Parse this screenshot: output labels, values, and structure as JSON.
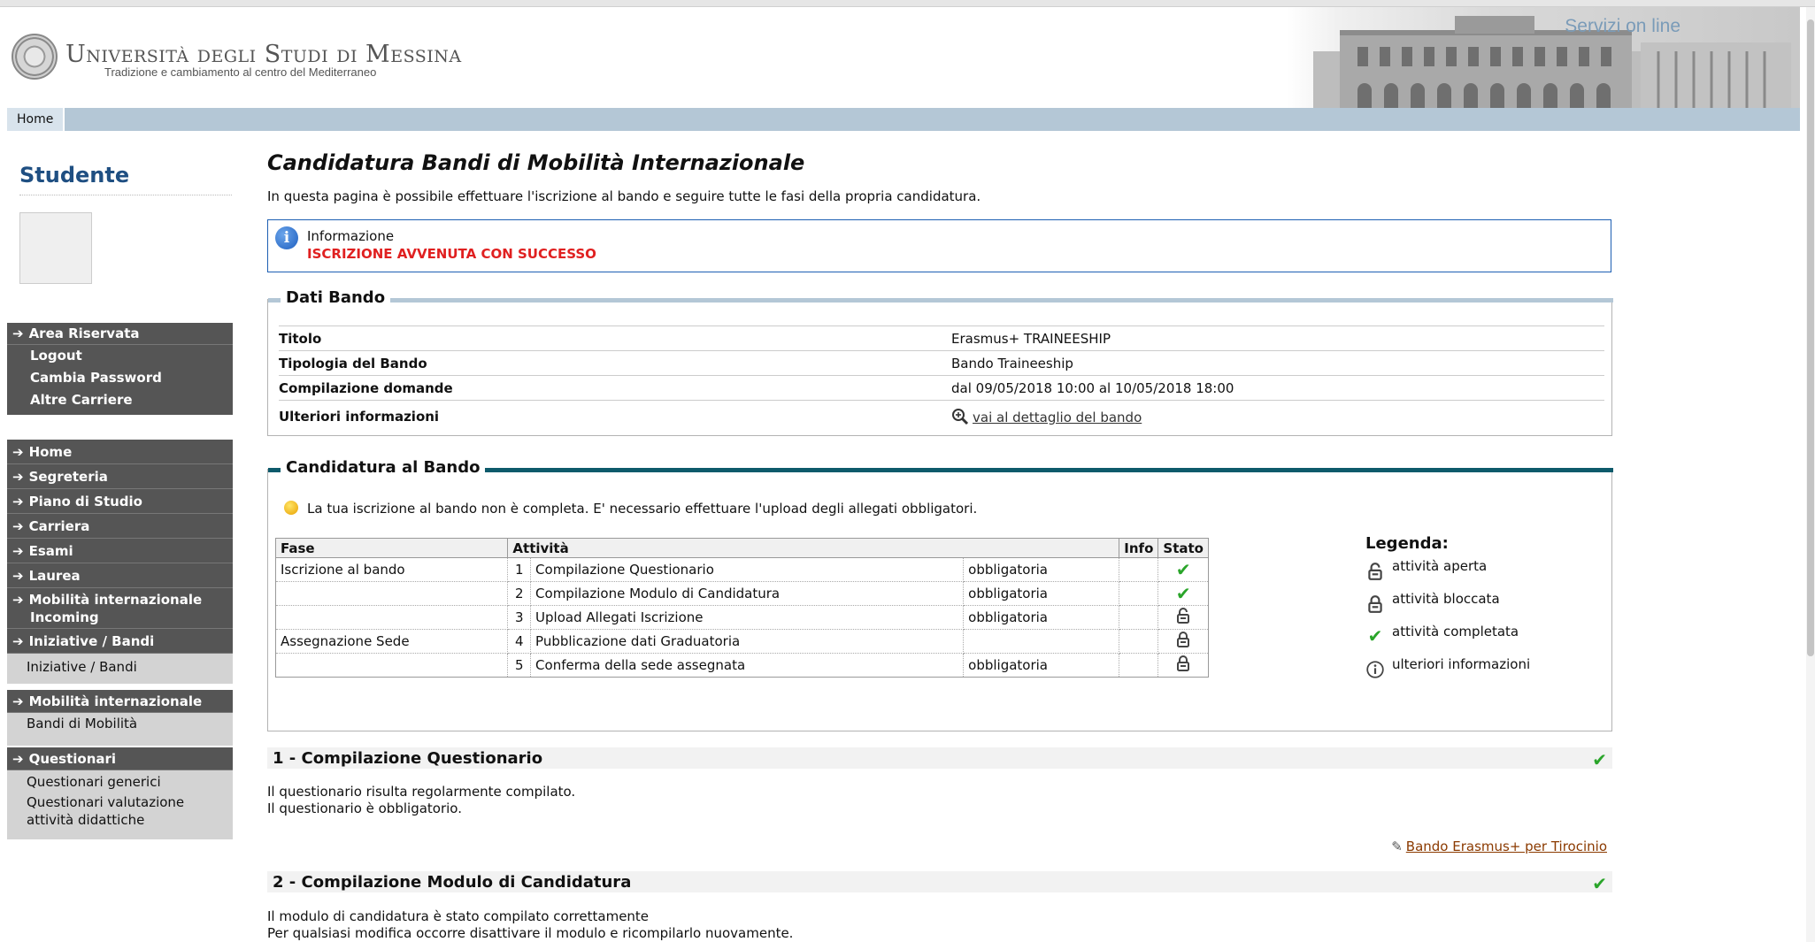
{
  "header": {
    "university": "Università degli Studi di Messina",
    "motto": "Tradizione e cambiamento al centro del Mediterraneo",
    "banner_title": "Servizi on line"
  },
  "navbar": {
    "home": "Home"
  },
  "sidebar": {
    "title": "Studente",
    "area": {
      "header": "Area Riservata",
      "items": [
        "Logout",
        "Cambia Password",
        "Altre Carriere"
      ]
    },
    "menu": [
      "Home",
      "Segreteria",
      "Piano di Studio",
      "Carriera",
      "Esami",
      "Laurea",
      "Mobilità internazionale Incoming",
      "Iniziative / Bandi"
    ],
    "iniziative_sub": "Iniziative / Bandi",
    "mobilita_header": "Mobilità internazionale",
    "mobilita_sub": "Bandi di Mobilità",
    "questionari_header": "Questionari",
    "questionari_sub": [
      "Questionari generici",
      "Questionari valutazione attività didattiche"
    ]
  },
  "main": {
    "title": "Candidatura Bandi di Mobilità Internazionale",
    "description": "In questa pagina è possibile effettuare l'iscrizione al bando e seguire tutte le fasi della propria candidatura.",
    "info": {
      "label": "Informazione",
      "message": "ISCRIZIONE AVVENUTA CON SUCCESSO"
    },
    "dati_bando": {
      "legend": "Dati Bando",
      "rows": [
        {
          "key": "Titolo",
          "value": "Erasmus+ TRAINEESHIP"
        },
        {
          "key": "Tipologia del Bando",
          "value": "Bando Traineeship"
        },
        {
          "key": "Compilazione domande",
          "value": "dal 09/05/2018 10:00 al 10/05/2018 18:00"
        },
        {
          "key": "Ulteriori informazioni",
          "value": "vai al dettaglio del bando"
        }
      ]
    },
    "candidatura": {
      "legend": "Candidatura al Bando",
      "note": "La tua iscrizione al bando non è completa. E' necessario effettuare l'upload degli allegati obbligatori.",
      "headers": {
        "fase": "Fase",
        "attivita": "Attività",
        "info": "Info",
        "stato": "Stato"
      },
      "rows": [
        {
          "fase": "Iscrizione al bando",
          "num": "1",
          "attivita": "Compilazione Questionario",
          "obbl": "obbligatoria",
          "stato": "completed"
        },
        {
          "fase": "",
          "num": "2",
          "attivita": "Compilazione Modulo di Candidatura",
          "obbl": "obbligatoria",
          "stato": "completed"
        },
        {
          "fase": "",
          "num": "3",
          "attivita": "Upload Allegati Iscrizione",
          "obbl": "obbligatoria",
          "stato": "open"
        },
        {
          "fase": "Assegnazione Sede",
          "num": "4",
          "attivita": "Pubblicazione dati Graduatoria",
          "obbl": "",
          "stato": "locked"
        },
        {
          "fase": "",
          "num": "5",
          "attivita": "Conferma della sede assegnata",
          "obbl": "obbligatoria",
          "stato": "locked"
        }
      ],
      "legenda": {
        "title": "Legenda:",
        "items": [
          {
            "icon": "lock-open-icon",
            "label": "attività aperta"
          },
          {
            "icon": "lock-closed-icon",
            "label": "attività bloccata"
          },
          {
            "icon": "check-icon",
            "label": "attività completata"
          },
          {
            "icon": "info-icon",
            "label": "ulteriori informazioni"
          }
        ]
      }
    },
    "section1": {
      "title": "1 - Compilazione Questionario",
      "lines": [
        "Il questionario risulta regolarmente compilato.",
        "Il questionario è obbligatorio."
      ],
      "link": "Bando Erasmus+ per Tirocinio"
    },
    "section2": {
      "title": "2 - Compilazione Modulo di Candidatura",
      "lines": [
        "Il modulo di candidatura è stato compilato correttamente",
        "Per qualsiasi modifica occorre disattivare il modulo e ricompilarlo nuovamente."
      ]
    }
  },
  "colors": {
    "nav_bar": "#b4c7d6",
    "sidebar_dark": "#555555",
    "title_blue": "#1f4f82",
    "success_red": "#e02020",
    "check_green": "#2aa52a",
    "bar_teal": "#0d5a6b"
  }
}
